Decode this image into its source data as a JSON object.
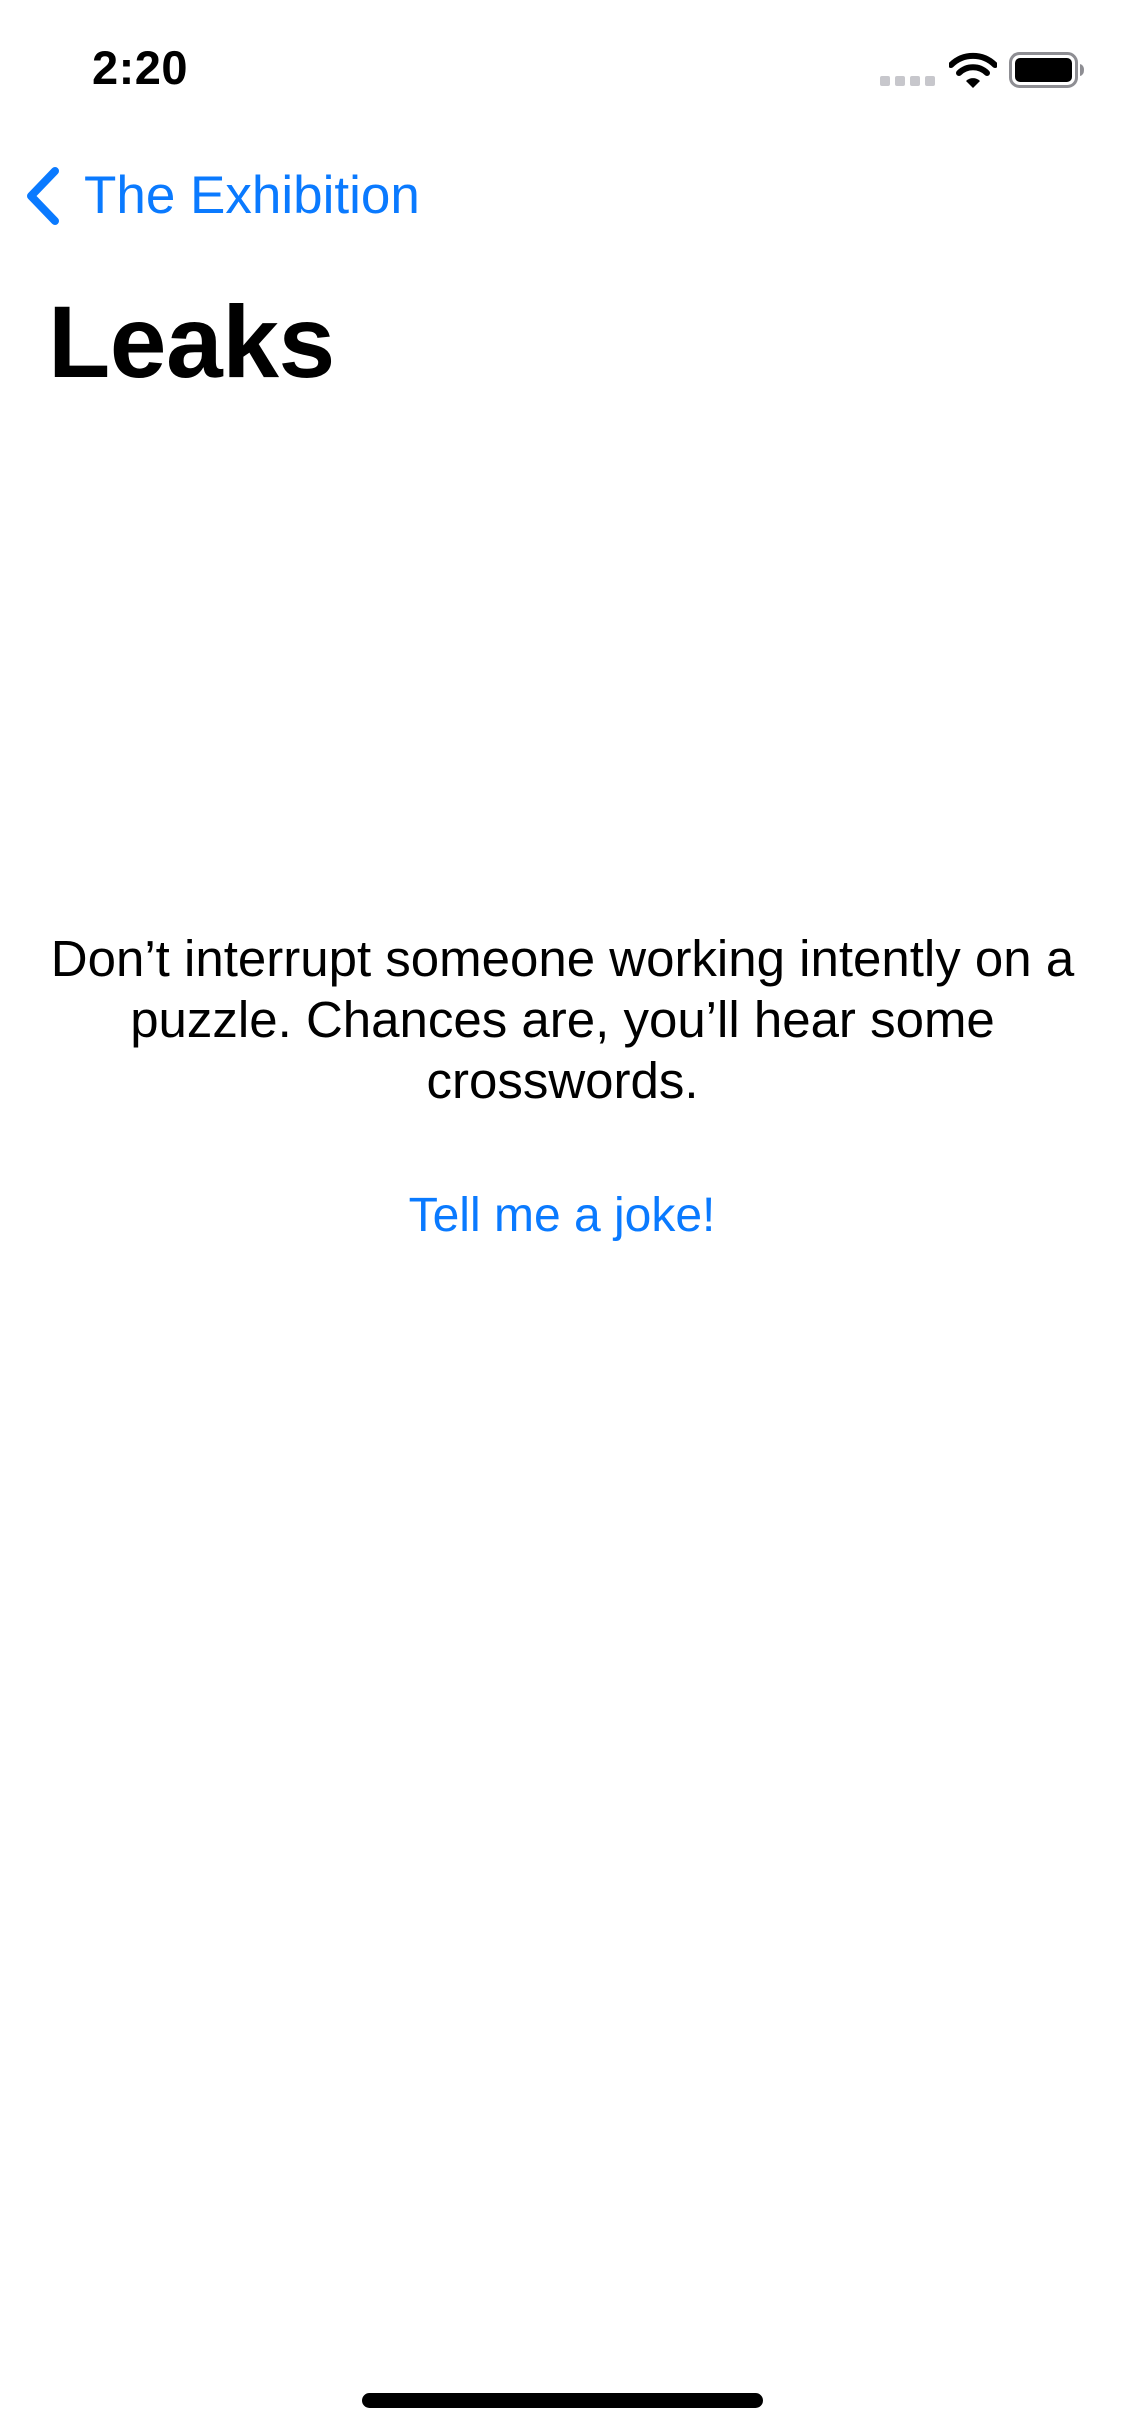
{
  "status_bar": {
    "time": "2:20",
    "icons": [
      "cellular-signal-icon",
      "wifi-icon",
      "battery-icon"
    ],
    "signal_level": 0,
    "battery_level": 1.0
  },
  "navigation": {
    "back_label": "The Exhibition",
    "back_icon": "chevron-left-icon",
    "title": "Leaks"
  },
  "content": {
    "joke": "Don’t interrupt someone working intently on a puzzle. Chances are, you’ll hear some crosswords.",
    "button_label": "Tell me a joke!"
  },
  "colors": {
    "accent": "#0a7aff",
    "text": "#000000",
    "background": "#ffffff"
  }
}
